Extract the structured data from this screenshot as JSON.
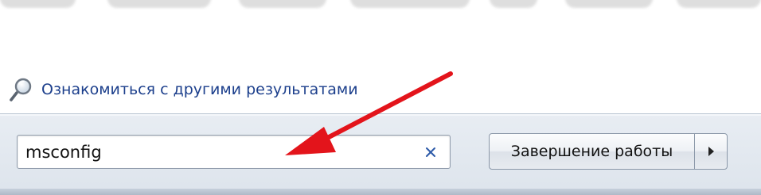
{
  "results": {
    "more_results_label": "Ознакомиться с другими результатами",
    "more_results_icon": "magnifier-icon"
  },
  "search": {
    "value": "msconfig",
    "clear_icon": "clear-x-icon"
  },
  "shutdown": {
    "label": "Завершение работы",
    "options_icon": "triangle-right-icon"
  },
  "annotation": {
    "color": "#e3141b"
  },
  "colors": {
    "link": "#1c3f8c",
    "bar_background": "#e2e8ef"
  }
}
